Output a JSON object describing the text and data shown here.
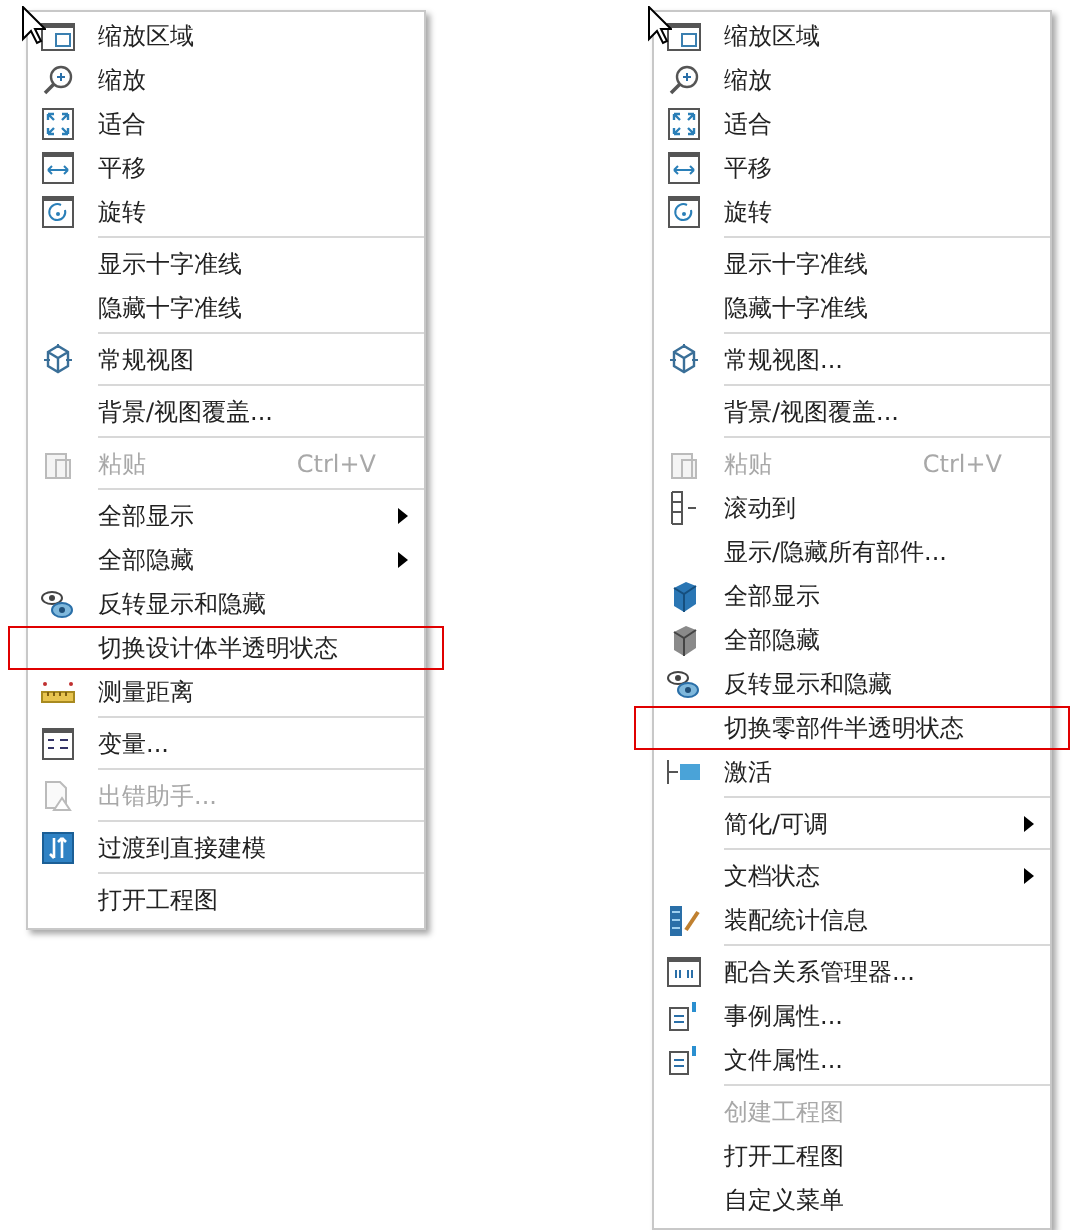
{
  "menus": [
    {
      "items": [
        {
          "kind": "zoom-area",
          "label": "缩放区域",
          "disabled": false,
          "highlighted": false
        },
        {
          "kind": "magnifier",
          "label": "缩放",
          "disabled": false,
          "highlighted": false
        },
        {
          "kind": "fit",
          "label": "适合",
          "disabled": false,
          "highlighted": false
        },
        {
          "kind": "pan",
          "label": "平移",
          "disabled": false,
          "highlighted": false
        },
        {
          "kind": "rotate",
          "label": "旋转",
          "disabled": false,
          "highlighted": false
        },
        {
          "kind": "separator"
        },
        {
          "kind": "plain",
          "label": "显示十字准线",
          "disabled": false,
          "highlighted": false
        },
        {
          "kind": "plain",
          "label": "隐藏十字准线",
          "disabled": false,
          "highlighted": false
        },
        {
          "kind": "separator"
        },
        {
          "kind": "cube",
          "label": "常规视图",
          "disabled": false,
          "highlighted": false
        },
        {
          "kind": "separator"
        },
        {
          "kind": "plain",
          "label": "背景/视图覆盖...",
          "disabled": false,
          "highlighted": false
        },
        {
          "kind": "separator"
        },
        {
          "kind": "clipboard",
          "label": "粘贴",
          "shortcut": "Ctrl+V",
          "disabled": true,
          "highlighted": false
        },
        {
          "kind": "separator"
        },
        {
          "kind": "plain",
          "label": "全部显示",
          "submenu": true,
          "disabled": false,
          "highlighted": false
        },
        {
          "kind": "plain",
          "label": "全部隐藏",
          "submenu": true,
          "disabled": false,
          "highlighted": false
        },
        {
          "kind": "eyes",
          "label": "反转显示和隐藏",
          "disabled": false,
          "highlighted": false
        },
        {
          "kind": "plain",
          "label": "切换设计体半透明状态",
          "disabled": false,
          "highlighted": true
        },
        {
          "kind": "ruler",
          "label": "测量距离",
          "disabled": false,
          "highlighted": false
        },
        {
          "kind": "separator"
        },
        {
          "kind": "variables",
          "label": "变量...",
          "disabled": false,
          "highlighted": false
        },
        {
          "kind": "separator"
        },
        {
          "kind": "document-warning",
          "label": "出错助手...",
          "disabled": true,
          "highlighted": false
        },
        {
          "kind": "separator"
        },
        {
          "kind": "arrows-up-down",
          "label": "过渡到直接建模",
          "disabled": false,
          "highlighted": false
        },
        {
          "kind": "separator"
        },
        {
          "kind": "plain",
          "label": "打开工程图",
          "disabled": false,
          "highlighted": false
        }
      ]
    },
    {
      "items": [
        {
          "kind": "zoom-area",
          "label": "缩放区域",
          "disabled": false,
          "highlighted": false
        },
        {
          "kind": "magnifier",
          "label": "缩放",
          "disabled": false,
          "highlighted": false
        },
        {
          "kind": "fit",
          "label": "适合",
          "disabled": false,
          "highlighted": false
        },
        {
          "kind": "pan",
          "label": "平移",
          "disabled": false,
          "highlighted": false
        },
        {
          "kind": "rotate",
          "label": "旋转",
          "disabled": false,
          "highlighted": false
        },
        {
          "kind": "separator"
        },
        {
          "kind": "plain",
          "label": "显示十字准线",
          "disabled": false,
          "highlighted": false
        },
        {
          "kind": "plain",
          "label": "隐藏十字准线",
          "disabled": false,
          "highlighted": false
        },
        {
          "kind": "separator"
        },
        {
          "kind": "cube",
          "label": "常规视图...",
          "disabled": false,
          "highlighted": false
        },
        {
          "kind": "separator"
        },
        {
          "kind": "plain",
          "label": "背景/视图覆盖...",
          "disabled": false,
          "highlighted": false
        },
        {
          "kind": "separator"
        },
        {
          "kind": "clipboard",
          "label": "粘贴",
          "shortcut": "Ctrl+V",
          "disabled": true,
          "highlighted": false
        },
        {
          "kind": "tree-arrow",
          "label": "滚动到",
          "disabled": false,
          "highlighted": false
        },
        {
          "kind": "plain",
          "label": "显示/隐藏所有部件...",
          "disabled": false,
          "highlighted": false
        },
        {
          "kind": "block",
          "label": "全部显示",
          "disabled": false,
          "highlighted": false
        },
        {
          "kind": "block-grey",
          "label": "全部隐藏",
          "disabled": false,
          "highlighted": false
        },
        {
          "kind": "eyes",
          "label": "反转显示和隐藏",
          "disabled": false,
          "highlighted": false
        },
        {
          "kind": "plain",
          "label": "切换零部件半透明状态",
          "disabled": false,
          "highlighted": true
        },
        {
          "kind": "activate",
          "label": "激活",
          "disabled": false,
          "highlighted": false
        },
        {
          "kind": "separator"
        },
        {
          "kind": "plain",
          "label": "简化/可调",
          "submenu": true,
          "disabled": false,
          "highlighted": false
        },
        {
          "kind": "separator"
        },
        {
          "kind": "plain",
          "label": "文档状态",
          "submenu": true,
          "disabled": false,
          "highlighted": false
        },
        {
          "kind": "stats",
          "label": "装配统计信息",
          "disabled": false,
          "highlighted": false
        },
        {
          "kind": "separator"
        },
        {
          "kind": "mates",
          "label": "配合关系管理器...",
          "disabled": false,
          "highlighted": false
        },
        {
          "kind": "properties",
          "label": "事例属性...",
          "disabled": false,
          "highlighted": false
        },
        {
          "kind": "properties",
          "label": "文件属性...",
          "disabled": false,
          "highlighted": false
        },
        {
          "kind": "separator"
        },
        {
          "kind": "plain",
          "label": "创建工程图",
          "disabled": true,
          "highlighted": false
        },
        {
          "kind": "plain",
          "label": "打开工程图",
          "disabled": false,
          "highlighted": false
        },
        {
          "kind": "plain",
          "label": "自定义菜单",
          "disabled": false,
          "highlighted": false
        }
      ]
    }
  ]
}
